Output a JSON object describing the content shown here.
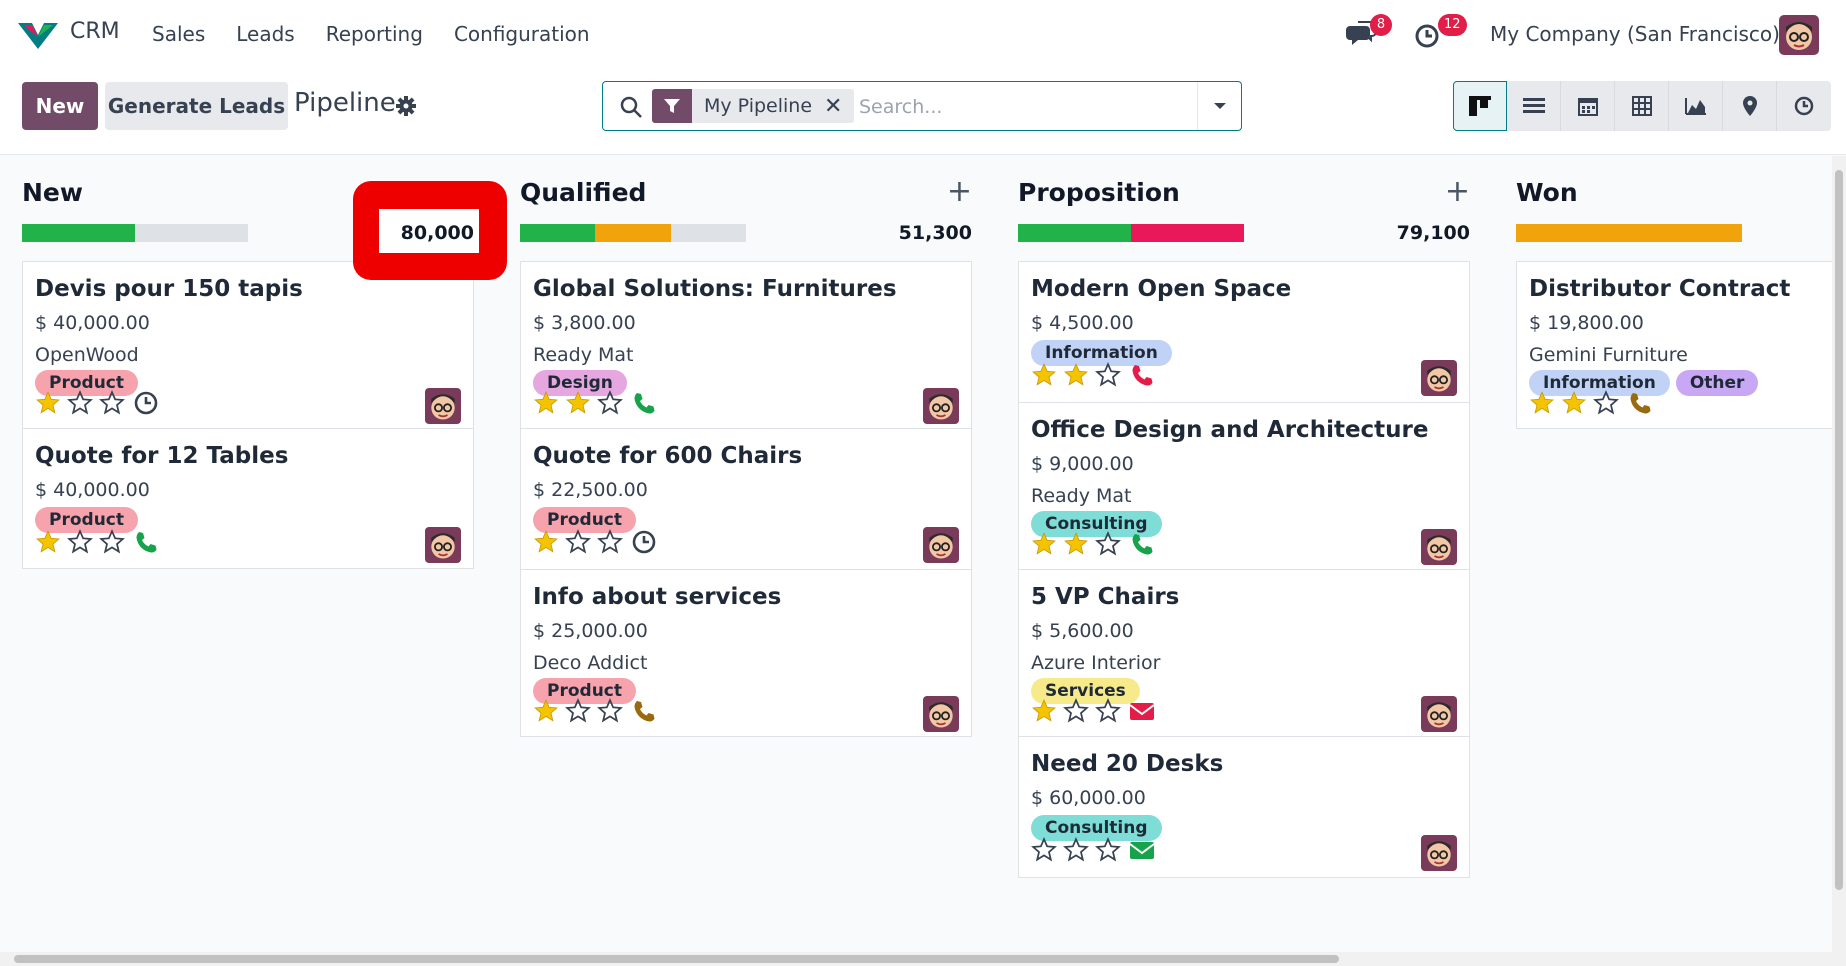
{
  "nav": {
    "app_name": "CRM",
    "menu": [
      "Sales",
      "Leads",
      "Reporting",
      "Configuration"
    ],
    "messages_badge": "8",
    "activities_badge": "12",
    "company": "My Company (San Francisco)"
  },
  "control": {
    "new_label": "New",
    "generate_label": "Generate Leads",
    "title": "Pipeline",
    "facet_label": "My Pipeline",
    "facet_remove": "✕",
    "search_placeholder": "Search..."
  },
  "colors": {
    "brand": "#714b67",
    "accent": "#017e84",
    "green": "#21b24a",
    "orange": "#f0a30a",
    "red": "#e8185a"
  },
  "columns": [
    {
      "title": "New",
      "total": "80,000",
      "show_plus": false,
      "progress": [
        {
          "color": "#21b24a",
          "fraction": 0.5
        }
      ],
      "cards": [
        {
          "title": "Devis pour 150 tapis",
          "amount": "$ 40,000.00",
          "customer": "OpenWood",
          "tags": [
            {
              "label": "Product",
              "color": "#f7a3ad"
            }
          ],
          "stars": 1,
          "activity": "clock-icon",
          "height": 168
        },
        {
          "title": "Quote for 12 Tables",
          "amount": "$ 40,000.00",
          "customer": "",
          "tags": [
            {
              "label": "Product",
              "color": "#f7a3ad"
            }
          ],
          "stars": 1,
          "activity": "phone-icon-green",
          "height": 141
        }
      ]
    },
    {
      "title": "Qualified",
      "total": "51,300",
      "show_plus": true,
      "plus": "+",
      "progress": [
        {
          "color": "#21b24a",
          "fraction": 0.333
        },
        {
          "color": "#f0a30a",
          "fraction": 0.333
        }
      ],
      "cards": [
        {
          "title": "Global Solutions: Furnitures",
          "amount": "$ 3,800.00",
          "customer": "Ready Mat",
          "tags": [
            {
              "label": "Design",
              "color": "#e6a6e0"
            }
          ],
          "stars": 2,
          "activity": "phone-icon-green",
          "height": 168
        },
        {
          "title": "Quote for 600 Chairs",
          "amount": "$ 22,500.00",
          "customer": "",
          "tags": [
            {
              "label": "Product",
              "color": "#f7a3ad"
            }
          ],
          "stars": 1,
          "activity": "clock-icon",
          "height": 142
        },
        {
          "title": "Info about services",
          "amount": "$ 25,000.00",
          "customer": "Deco Addict",
          "tags": [
            {
              "label": "Product",
              "color": "#f7a3ad"
            }
          ],
          "stars": 1,
          "activity": "phone-icon-brown",
          "height": 168
        }
      ]
    },
    {
      "title": "Proposition",
      "total": "79,100",
      "show_plus": true,
      "plus": "+",
      "progress": [
        {
          "color": "#21b24a",
          "fraction": 0.5
        },
        {
          "color": "#e8185a",
          "fraction": 0.5
        }
      ],
      "cards": [
        {
          "title": "Modern Open Space",
          "amount": "$ 4,500.00",
          "customer": "",
          "tags": [
            {
              "label": "Information",
              "color": "#c0d2f6"
            }
          ],
          "stars": 2,
          "activity": "phone-icon-red",
          "height": 142
        },
        {
          "title": "Office Design and Architecture",
          "amount": "$ 9,000.00",
          "customer": "Ready Mat",
          "tags": [
            {
              "label": "Consulting",
              "color": "#7eddd6"
            }
          ],
          "stars": 2,
          "activity": "phone-icon-green",
          "height": 168
        },
        {
          "title": "5 VP Chairs",
          "amount": "$ 5,600.00",
          "customer": "Azure Interior",
          "tags": [
            {
              "label": "Services",
              "color": "#f7ea8a"
            }
          ],
          "stars": 1,
          "activity": "envelope-icon",
          "height": 168
        },
        {
          "title": "Need 20 Desks",
          "amount": "$ 60,000.00",
          "customer": "",
          "tags": [
            {
              "label": "Consulting",
              "color": "#7eddd6"
            }
          ],
          "stars": 0,
          "activity": "envelope-icon-green",
          "height": 142
        }
      ]
    },
    {
      "title": "Won",
      "total": "",
      "show_plus": false,
      "progress": [
        {
          "color": "#f0a30a",
          "fraction": 1
        }
      ],
      "cards": [
        {
          "title": "Distributor Contract",
          "amount": "$ 19,800.00",
          "customer": "Gemini Furniture",
          "tags": [
            {
              "label": "Information",
              "color": "#c0d2f6"
            },
            {
              "label": "Other",
              "color": "#c8a8f5"
            }
          ],
          "stars": 2,
          "activity": "phone-icon-brown",
          "height": 168,
          "no_avatar": true
        }
      ]
    }
  ]
}
